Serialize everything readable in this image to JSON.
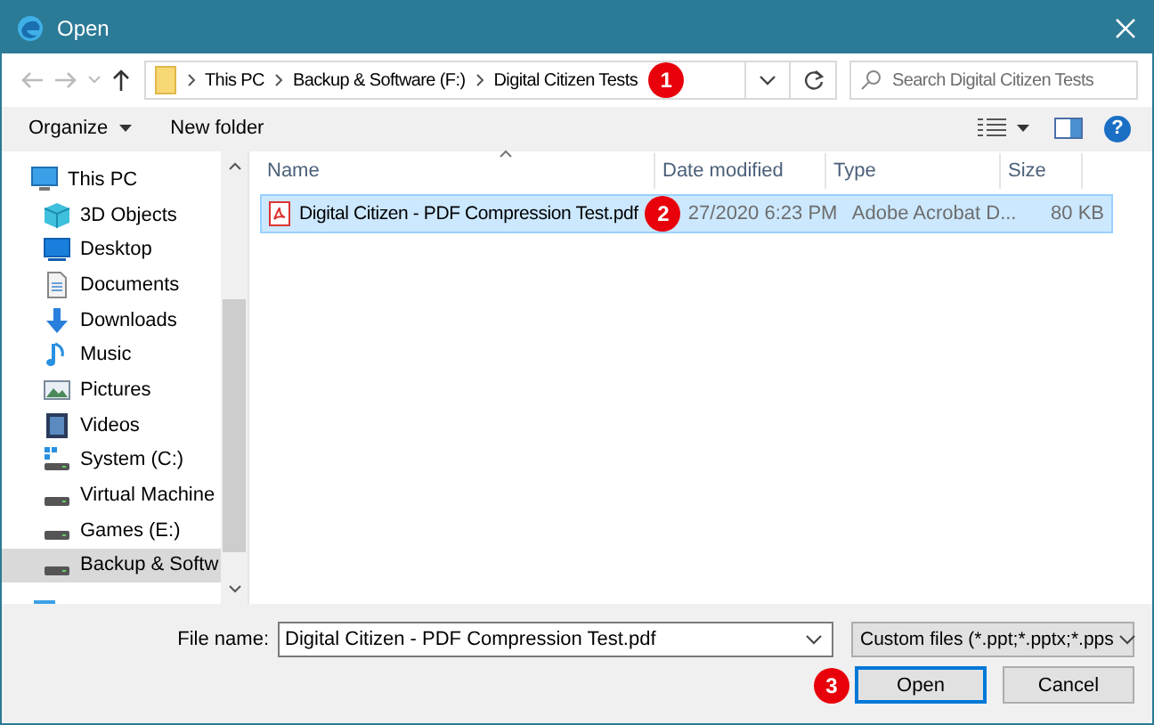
{
  "window": {
    "title": "Open"
  },
  "navigation": {
    "path": [
      {
        "label": "This PC"
      },
      {
        "label": "Backup & Software (F:)"
      },
      {
        "label": "Digital Citizen Tests"
      }
    ],
    "search": {
      "placeholder": "Search Digital Citizen Tests"
    }
  },
  "toolbar": {
    "organize": "Organize",
    "new_folder": "New folder",
    "help": "?"
  },
  "sidebar": {
    "items": [
      {
        "label": "This PC",
        "kind": "pc",
        "selected": false,
        "children": [
          {
            "label": "3D Objects",
            "kind": "objects",
            "selected": false
          },
          {
            "label": "Desktop",
            "kind": "desktop",
            "selected": false
          },
          {
            "label": "Documents",
            "kind": "documents",
            "selected": false
          },
          {
            "label": "Downloads",
            "kind": "downloads",
            "selected": false
          },
          {
            "label": "Music",
            "kind": "music",
            "selected": false
          },
          {
            "label": "Pictures",
            "kind": "pictures",
            "selected": false
          },
          {
            "label": "Videos",
            "kind": "videos",
            "selected": false
          },
          {
            "label": "System (C:)",
            "kind": "system",
            "selected": false
          },
          {
            "label": "Virtual Machine",
            "kind": "drive",
            "selected": false
          },
          {
            "label": "Games (E:)",
            "kind": "drive",
            "selected": false
          },
          {
            "label": "Backup & Softw",
            "kind": "drive",
            "selected": true
          }
        ]
      }
    ]
  },
  "table": {
    "columns": [
      "Name",
      "Date modified",
      "Type",
      "Size"
    ],
    "rows": [
      {
        "name": "Digital Citizen - PDF Compression Test.pdf",
        "date": "27/2020 6:23 PM",
        "type": "Adobe Acrobat D...",
        "size": "80 KB",
        "selected": true
      }
    ]
  },
  "footer": {
    "file_name_label": "File name:",
    "file_name": "Digital Citizen - PDF Compression Test.pdf",
    "filter": "Custom files (*.ppt;*.pptx;*.pps",
    "buttons": [
      {
        "label": "Open",
        "default": true
      },
      {
        "label": "Cancel",
        "default": false
      }
    ]
  },
  "callouts": [
    {
      "number": "1"
    },
    {
      "number": "2"
    },
    {
      "number": "3"
    }
  ]
}
